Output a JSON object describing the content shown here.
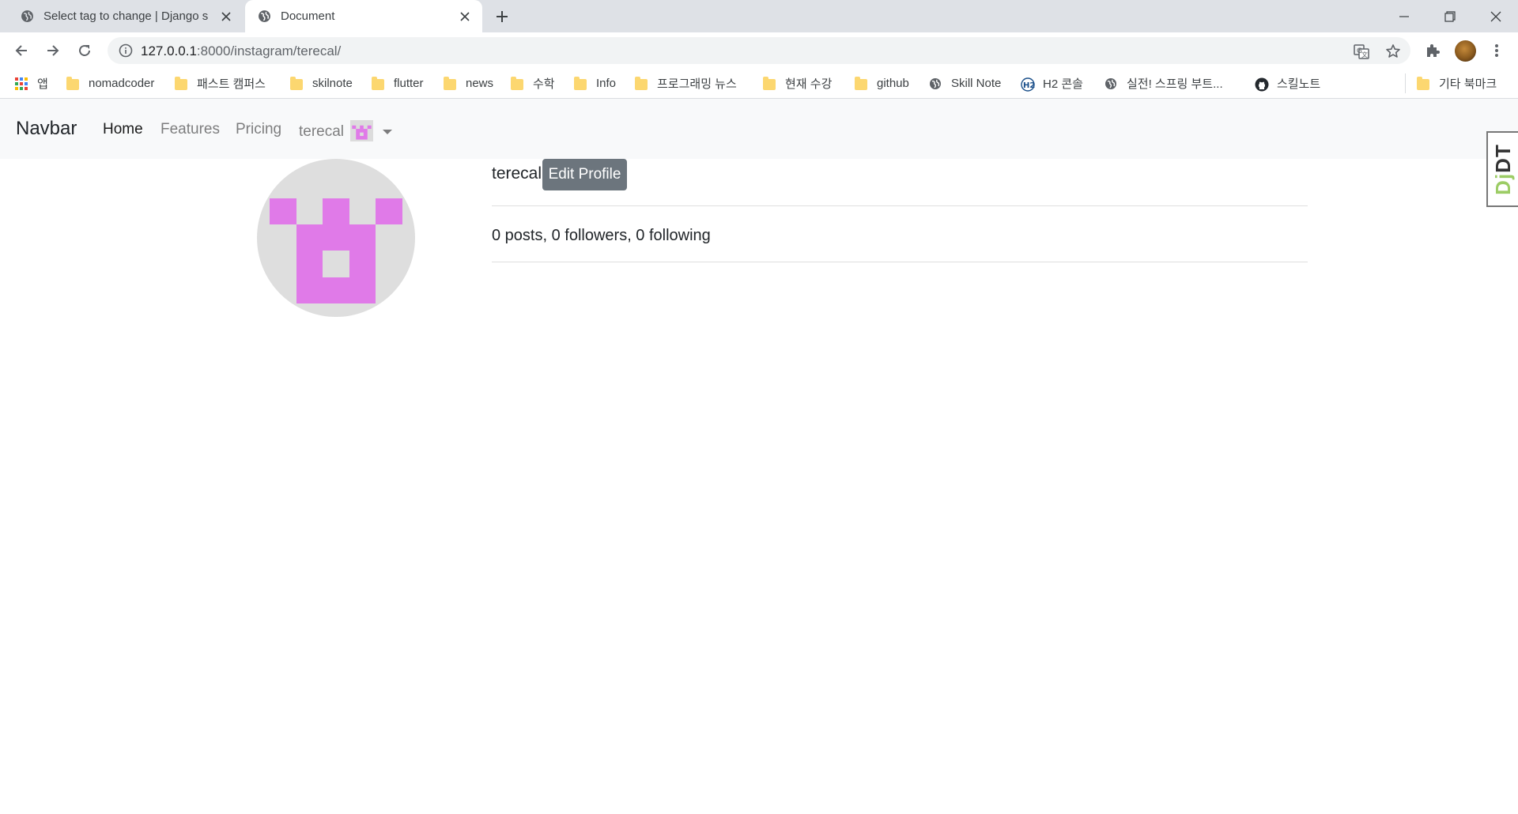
{
  "browser": {
    "tabs": [
      {
        "title": "Select tag to change | Django s",
        "active": false
      },
      {
        "title": "Document",
        "active": true
      }
    ],
    "url": {
      "host": "127.0.0.1",
      "rest": ":8000/instagram/terecal/"
    },
    "bookmarks": [
      {
        "label": "앱",
        "icon": "apps-grid-icon"
      },
      {
        "label": "nomadcoder",
        "icon": "folder-icon"
      },
      {
        "label": "패스트 캠퍼스",
        "icon": "folder-icon"
      },
      {
        "label": "skilnote",
        "icon": "folder-icon"
      },
      {
        "label": "flutter",
        "icon": "folder-icon"
      },
      {
        "label": "news",
        "icon": "folder-icon"
      },
      {
        "label": "수학",
        "icon": "folder-icon"
      },
      {
        "label": "Info",
        "icon": "folder-icon"
      },
      {
        "label": "프로그래밍 뉴스",
        "icon": "folder-icon"
      },
      {
        "label": "현재 수강",
        "icon": "folder-icon"
      },
      {
        "label": "github",
        "icon": "folder-icon"
      },
      {
        "label": "Skill Note",
        "icon": "globe-icon"
      },
      {
        "label": "H2 콘솔",
        "icon": "h2-icon"
      },
      {
        "label": "실전! 스프링 부트...",
        "icon": "globe-icon"
      },
      {
        "label": "스킬노트",
        "icon": "github-icon"
      }
    ],
    "other_bookmarks": "기타 북마크"
  },
  "navbar": {
    "brand": "Navbar",
    "links": [
      "Home",
      "Features",
      "Pricing"
    ],
    "active_link": "Home",
    "user": "terecal"
  },
  "djdt": {
    "label_a": "Dj",
    "label_b": "DT"
  },
  "profile": {
    "username": "terecal",
    "edit_button": "Edit Profile",
    "stats": "0 posts, 0 followers, 0 following"
  },
  "colors": {
    "avatar_fg": "#e07ae8",
    "avatar_bg": "#dedede",
    "button_secondary": "#6c757d"
  }
}
